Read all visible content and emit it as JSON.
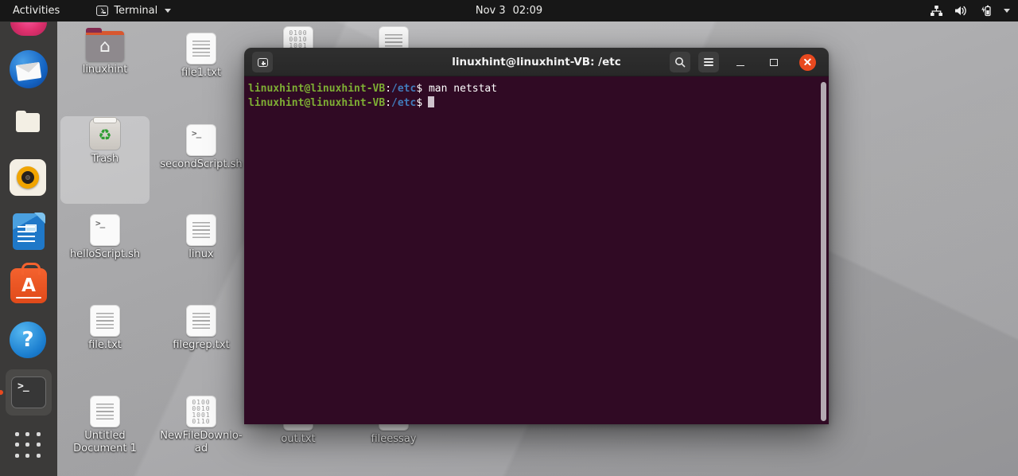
{
  "topbar": {
    "activities_label": "Activities",
    "focused_app_label": "Terminal",
    "clock": {
      "date": "Nov 3",
      "time": "02:09"
    },
    "tray_icons": [
      "network-wired-icon",
      "volume-icon",
      "battery-charging-icon",
      "chevron-down-icon"
    ]
  },
  "dock": {
    "items": [
      {
        "name": "firefox",
        "partial": true
      },
      {
        "name": "thunderbird"
      },
      {
        "name": "files"
      },
      {
        "name": "rhythmbox"
      },
      {
        "name": "libreoffice-writer"
      },
      {
        "name": "ubuntu-software"
      },
      {
        "name": "help"
      },
      {
        "name": "terminal",
        "active": true
      },
      {
        "name": "show-applications"
      }
    ],
    "glyphs": {
      "terminal_prompt": ">_",
      "software_letter": "A",
      "help_mark": "?"
    }
  },
  "desktop": {
    "icons": [
      {
        "label": "linuxhint",
        "type": "folder-home"
      },
      {
        "label": "file1.txt",
        "type": "text"
      },
      {
        "label": "",
        "type": "binary-partial"
      },
      {
        "label": "",
        "type": "text-partial"
      },
      {
        "label": "Trash",
        "type": "trash",
        "selected": true
      },
      {
        "label": "secondScript.sh",
        "type": "script"
      },
      {
        "label": "helloScript.sh",
        "type": "script"
      },
      {
        "label": "linux",
        "type": "text"
      },
      {
        "label": "file.txt",
        "type": "text"
      },
      {
        "label": "filegrep.txt",
        "type": "text"
      },
      {
        "label": "Untitled",
        "label2": "Document 1",
        "type": "text"
      },
      {
        "label": "NewFileDownlo-",
        "label2": "ad",
        "type": "binary"
      },
      {
        "label": "out.txt",
        "type": "text"
      },
      {
        "label": "fileessay",
        "type": "text"
      }
    ],
    "glyphs": {
      "home": "⌂",
      "recycle": "♻",
      "script_prompt": ">_",
      "binary_bits": "0100\n0010\n1001\n0110"
    }
  },
  "terminal": {
    "title": "linuxhint@linuxhint-VB: /etc",
    "prompt": {
      "user": "linuxhint@linuxhint-VB",
      "colon": ":",
      "path": "/etc",
      "dollar": "$"
    },
    "lines": [
      {
        "command": " man netstat"
      },
      {
        "command": ""
      }
    ],
    "colors": {
      "background": "#300a24",
      "user_green": "#7eae34",
      "path_blue": "#4179b8",
      "foreground": "#ffffff",
      "titlebar": "#2d2d2d",
      "close_button": "#e8491f"
    }
  }
}
